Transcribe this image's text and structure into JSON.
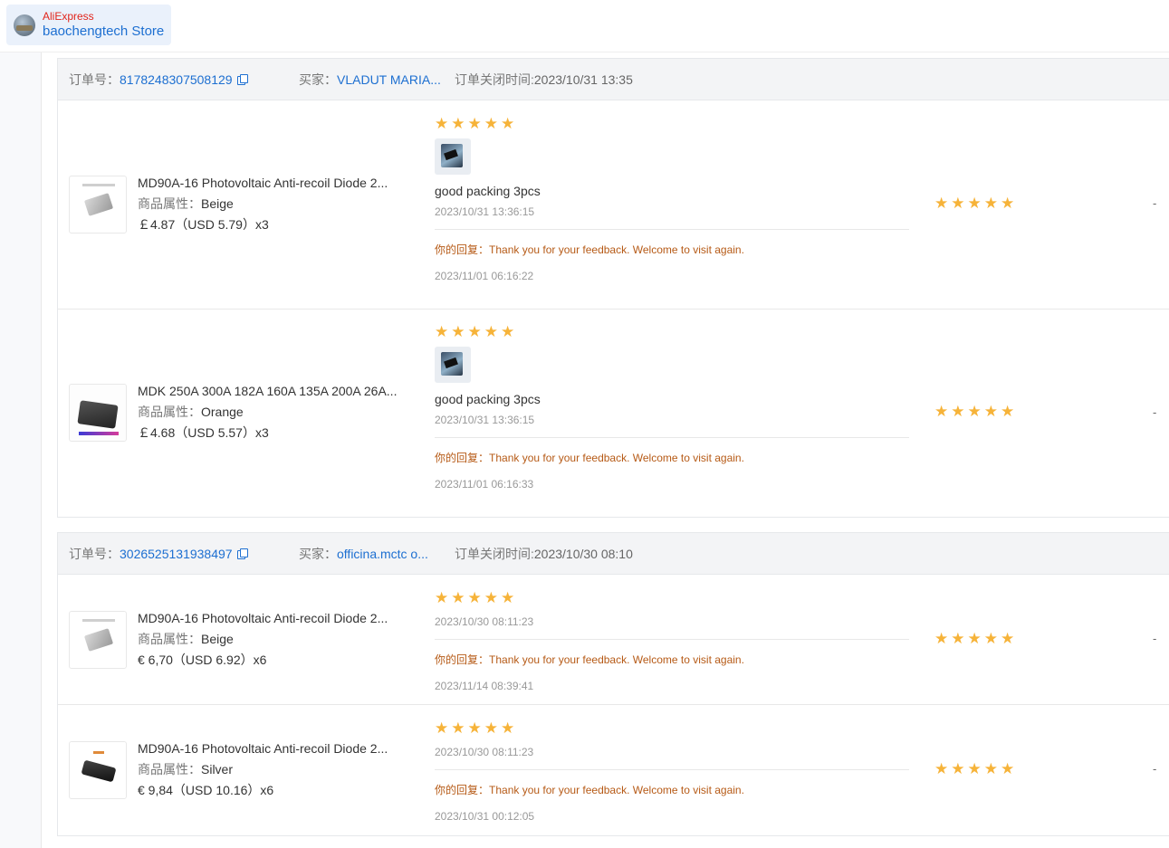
{
  "store": {
    "brand": "AliExpress",
    "name": "baochengtech Store"
  },
  "labels": {
    "order_no": "订单号：",
    "buyer": "买家：",
    "close_time": "订单关闭时间:",
    "attr": "商品属性：",
    "reply": "你的回复："
  },
  "orders": [
    {
      "order_no": "8178248307508129",
      "buyer": "VLADUT MARIA...",
      "close_time": "2023/10/31 13:35",
      "items": [
        {
          "title": "MD90A-16 Photovoltaic Anti-recoil Diode 2...",
          "attr": "Beige",
          "price": "￡4.87（USD  5.79）x3",
          "review_rating": 5,
          "has_photo": true,
          "review_text": "good packing 3pcs",
          "review_date": "2023/10/31 13:36:15",
          "reply": "Thank you for your feedback. Welcome to visit again.",
          "reply_date": "2023/11/01 06:16:22",
          "seller_rating": 5,
          "extra": "-"
        },
        {
          "title": "MDK 250A 300A 182A 160A 135A 200A 26A...",
          "attr": "Orange",
          "price": "￡4.68（USD  5.57）x3",
          "review_rating": 5,
          "has_photo": true,
          "review_text": "good packing 3pcs",
          "review_date": "2023/10/31 13:36:15",
          "reply": "Thank you for your feedback. Welcome to visit again.",
          "reply_date": "2023/11/01 06:16:33",
          "seller_rating": 5,
          "extra": "-"
        }
      ]
    },
    {
      "order_no": "3026525131938497",
      "buyer": "officina.mctc o...",
      "close_time": "2023/10/30 08:10",
      "items": [
        {
          "title": "MD90A-16 Photovoltaic Anti-recoil Diode 2...",
          "attr": "Beige",
          "price": "€ 6,70（USD  6.92）x6",
          "review_rating": 5,
          "has_photo": false,
          "review_text": "",
          "review_date": "2023/10/30 08:11:23",
          "reply": "Thank you for your feedback. Welcome to visit again.",
          "reply_date": "2023/11/14 08:39:41",
          "seller_rating": 5,
          "extra": "-"
        },
        {
          "title": "MD90A-16 Photovoltaic Anti-recoil Diode 2...",
          "attr": "Silver",
          "price": "€ 9,84（USD  10.16）x6",
          "review_rating": 5,
          "has_photo": false,
          "review_text": "",
          "review_date": "2023/10/30 08:11:23",
          "reply": "Thank you for your feedback. Welcome to visit again.",
          "reply_date": "2023/10/31 00:12:05",
          "seller_rating": 5,
          "extra": "-"
        }
      ]
    }
  ],
  "icons": {
    "star": "star-icon",
    "copy": "copy-icon"
  },
  "colors": {
    "link": "#1d6fd1",
    "star": "#f6b339",
    "reply": "#b65a16",
    "brand": "#e1251b"
  }
}
